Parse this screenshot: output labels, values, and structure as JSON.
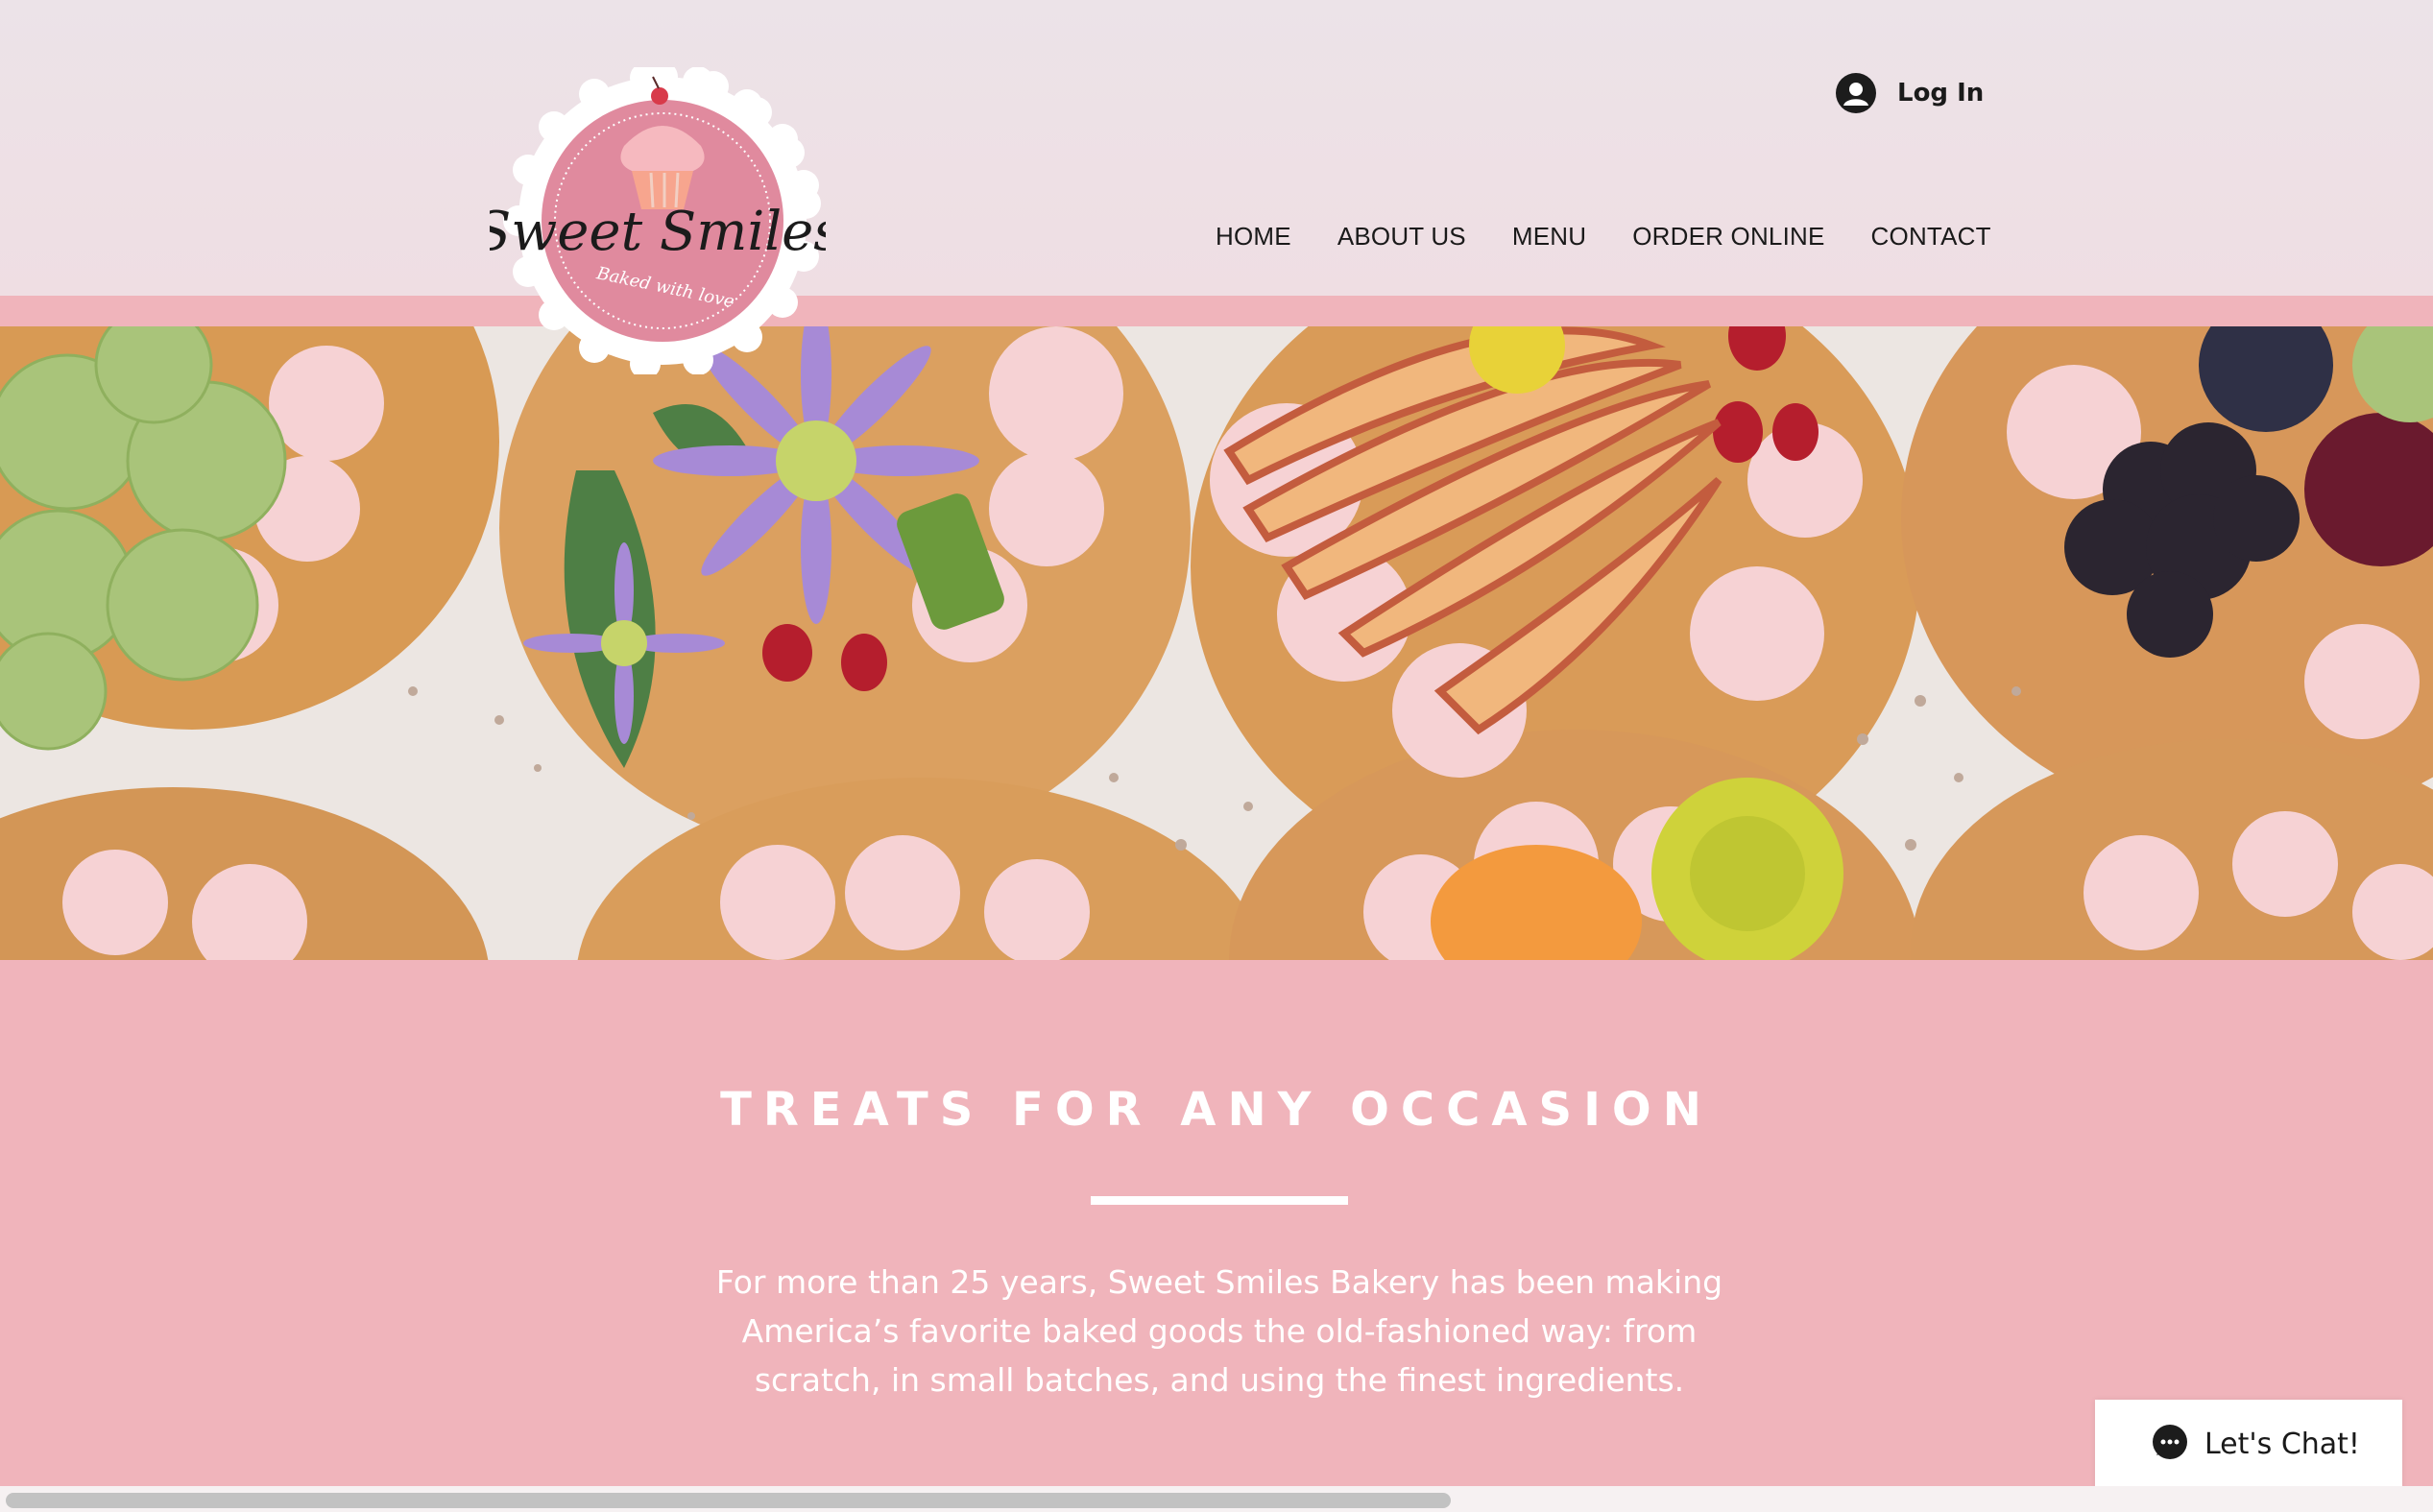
{
  "brand": {
    "name": "Sweet Smiles",
    "tagline": "Baked with love"
  },
  "header": {
    "login_label": "Log In",
    "nav": [
      {
        "label": "HOME"
      },
      {
        "label": "ABOUT US"
      },
      {
        "label": "MENU"
      },
      {
        "label": "ORDER ONLINE"
      },
      {
        "label": "CONTACT"
      }
    ]
  },
  "hero": {
    "image_icon": "cupcakes-photo"
  },
  "section": {
    "title": "TREATS FOR ANY OCCASION",
    "body": "For more than 25 years, Sweet Smiles Bakery has been making America’s favorite baked goods the old-fashioned way: from scratch, in small batches, and using the finest ingredients."
  },
  "chat": {
    "label": "Let's Chat!"
  },
  "colors": {
    "accent_pink": "#f0b4bb",
    "header_bg": "#ece3e8",
    "text_dark": "#1a1a1a"
  }
}
